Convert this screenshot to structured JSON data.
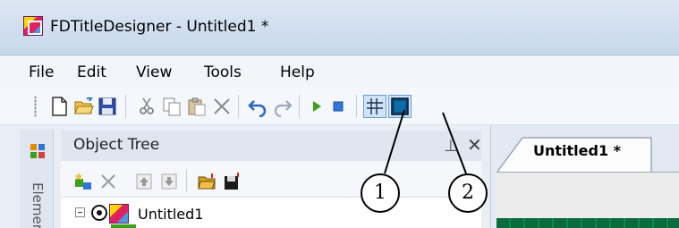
{
  "window": {
    "title": "FDTitleDesigner - Untitled1 *"
  },
  "menubar": {
    "items": [
      "File",
      "Edit",
      "View",
      "Tools",
      "Help"
    ]
  },
  "toolbar": {
    "buttons": [
      "new-document-icon",
      "open-folder-icon",
      "save-icon",
      "cut-icon",
      "copy-icon",
      "paste-icon",
      "delete-icon",
      "undo-icon",
      "redo-icon",
      "play-icon",
      "stop-icon",
      "grid-icon",
      "safe-area-icon"
    ]
  },
  "side_panel": {
    "label": "Elemen"
  },
  "object_tree": {
    "title": "Object Tree",
    "pin_glyph": "⊥",
    "close_glyph": "✕",
    "root_item": {
      "label": "Untitled1"
    }
  },
  "document": {
    "tab_label": "Untitled1 *"
  },
  "callouts": {
    "first": "1",
    "second": "2"
  },
  "colors": {
    "accent": "#3ca01b",
    "stop": "#2f76d8",
    "titlebar": "#c7d8ec"
  }
}
